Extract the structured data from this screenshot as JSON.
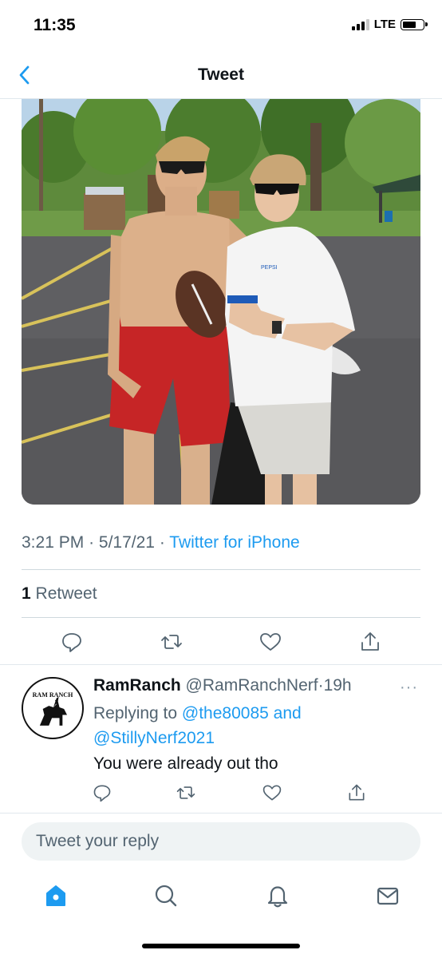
{
  "status_bar": {
    "time": "11:35",
    "network": "LTE",
    "battery_level": 0.7
  },
  "nav": {
    "title": "Tweet",
    "back_icon": "chevron-left-icon"
  },
  "tweet": {
    "time": "3:21 PM",
    "date": "5/17/21",
    "separator": "·",
    "source": "Twitter for iPhone",
    "retweet_count": "1",
    "retweet_label": "Retweet",
    "photo_alt_text": "PEPSI"
  },
  "reply": {
    "avatar_text": "RAM RANCH",
    "name": "RamRanch",
    "handle": "@RamRanchNerf",
    "separator": "·",
    "age": "19h",
    "more_icon": "···",
    "replying_prefix": "Replying to",
    "replying_user1": "@the80085",
    "replying_and": "and",
    "replying_user2": "@StillyNerf2021",
    "text": "You were already out tho"
  },
  "compose": {
    "placeholder": "Tweet your reply"
  },
  "colors": {
    "accent": "#1d9bf0",
    "secondary_text": "#536471",
    "divider": "#cfd9de"
  }
}
